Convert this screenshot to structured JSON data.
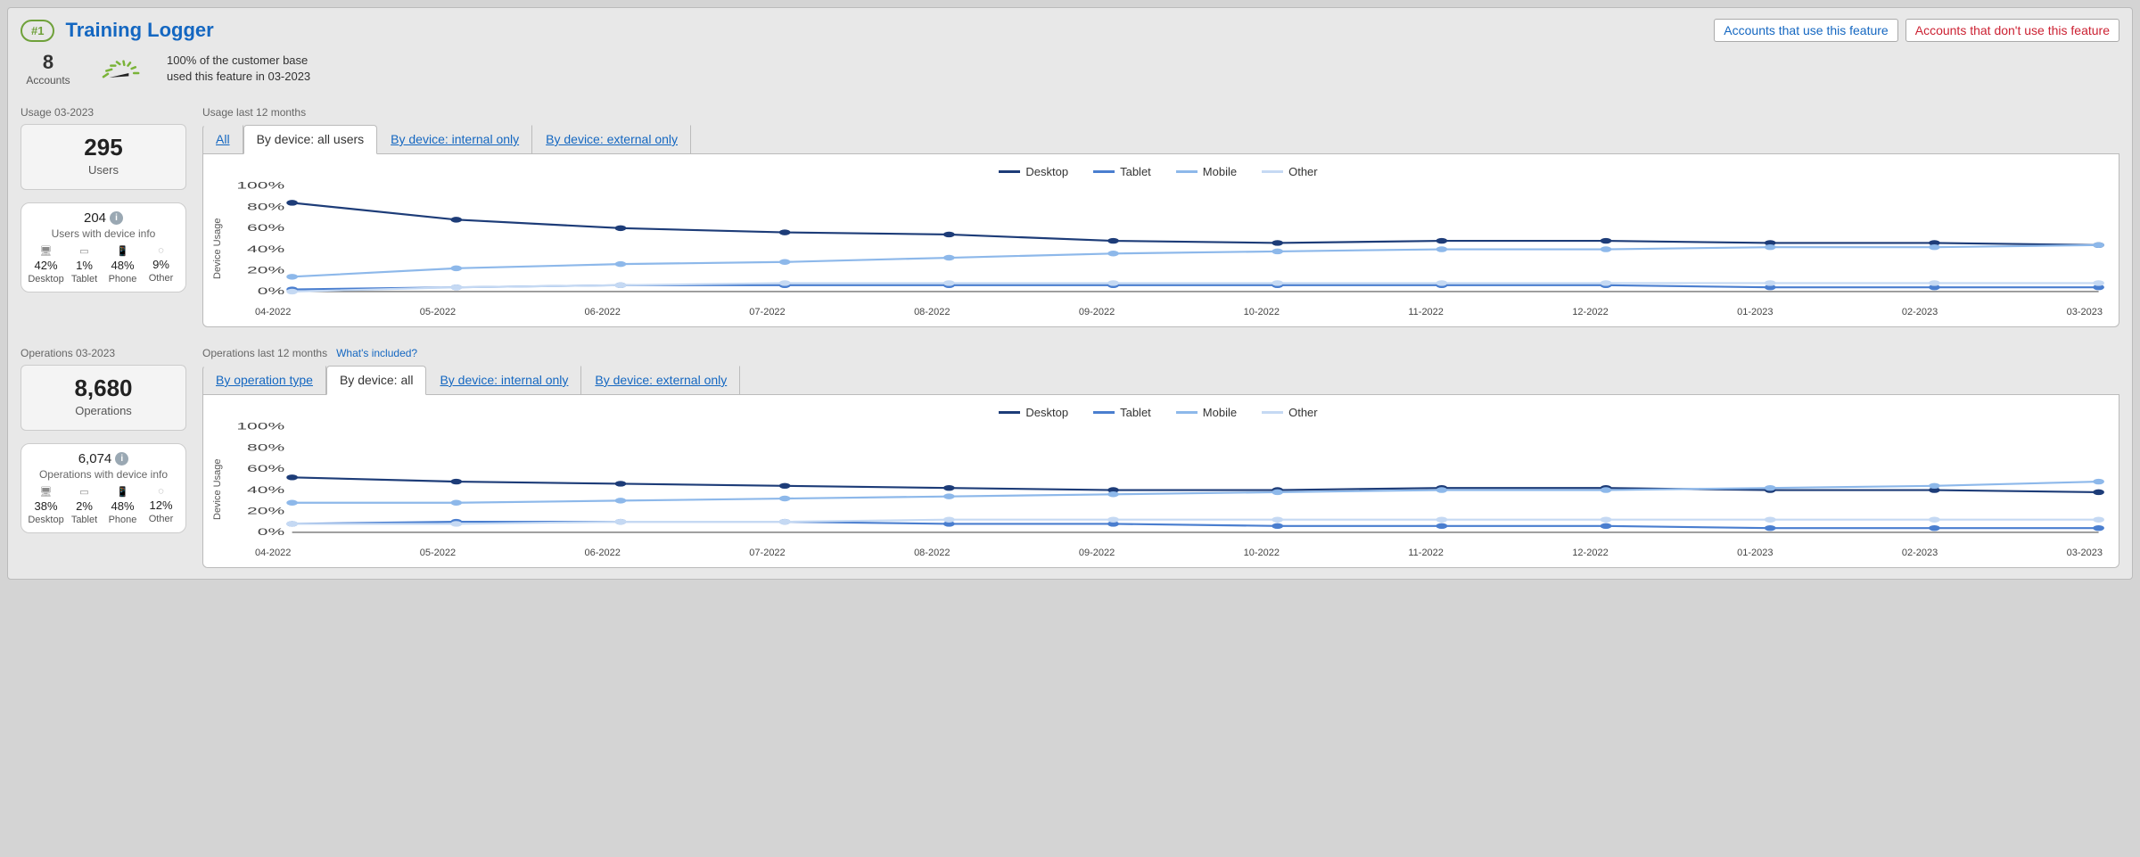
{
  "header": {
    "rank": "#1",
    "title": "Training Logger",
    "btn_use": "Accounts that use this feature",
    "btn_not_use": "Accounts that don't use this feature"
  },
  "summary": {
    "accounts_count": "8",
    "accounts_label": "Accounts",
    "line1": "100% of the customer base",
    "line2": "used this feature in 03-2023"
  },
  "usage": {
    "left_title": "Usage 03-2023",
    "right_title": "Usage last 12 months",
    "users_count": "295",
    "users_label": "Users",
    "device_count": "204",
    "device_label": "Users with device info",
    "breakdown": {
      "desktop": "42%",
      "tablet": "1%",
      "phone": "48%",
      "other": "9%"
    },
    "tabs": {
      "all": "All",
      "by_device_all": "By device: all users",
      "by_device_internal": "By device: internal only",
      "by_device_external": "By device: external only"
    },
    "ylabel": "Device Usage"
  },
  "operations": {
    "left_title": "Operations 03-2023",
    "right_title": "Operations last 12 months",
    "whats_included": "What's included?",
    "ops_count": "8,680",
    "ops_label": "Operations",
    "device_count": "6,074",
    "device_label": "Operations with device info",
    "breakdown": {
      "desktop": "38%",
      "tablet": "2%",
      "phone": "48%",
      "other": "12%"
    },
    "tabs": {
      "by_op_type": "By operation type",
      "by_device_all": "By device: all",
      "by_device_internal": "By device: internal only",
      "by_device_external": "By device: external only"
    },
    "ylabel": "Device Usage"
  },
  "legend": {
    "desktop": "Desktop",
    "tablet": "Tablet",
    "mobile": "Mobile",
    "other": "Other"
  },
  "device_names": {
    "desktop": "Desktop",
    "tablet": "Tablet",
    "phone": "Phone",
    "other": "Other"
  },
  "yticks": [
    "0%",
    "20%",
    "40%",
    "60%",
    "80%",
    "100%"
  ],
  "months": [
    "04-2022",
    "05-2022",
    "06-2022",
    "07-2022",
    "08-2022",
    "09-2022",
    "10-2022",
    "11-2022",
    "12-2022",
    "01-2023",
    "02-2023",
    "03-2023"
  ],
  "chart_data": [
    {
      "type": "line",
      "title": "Usage last 12 months — By device: all users",
      "ylabel": "Device Usage",
      "ylim": [
        0,
        100
      ],
      "x": [
        "04-2022",
        "05-2022",
        "06-2022",
        "07-2022",
        "08-2022",
        "09-2022",
        "10-2022",
        "11-2022",
        "12-2022",
        "01-2023",
        "02-2023",
        "03-2023"
      ],
      "series": [
        {
          "name": "Desktop",
          "values": [
            84,
            68,
            60,
            56,
            54,
            48,
            46,
            48,
            48,
            46,
            46,
            44
          ]
        },
        {
          "name": "Tablet",
          "values": [
            2,
            4,
            6,
            6,
            6,
            6,
            6,
            6,
            6,
            4,
            4,
            4
          ]
        },
        {
          "name": "Mobile",
          "values": [
            14,
            22,
            26,
            28,
            32,
            36,
            38,
            40,
            40,
            42,
            42,
            44
          ]
        },
        {
          "name": "Other",
          "values": [
            0,
            4,
            6,
            8,
            8,
            8,
            8,
            8,
            8,
            8,
            8,
            8
          ]
        }
      ]
    },
    {
      "type": "line",
      "title": "Operations last 12 months — By device: all",
      "ylabel": "Device Usage",
      "ylim": [
        0,
        100
      ],
      "x": [
        "04-2022",
        "05-2022",
        "06-2022",
        "07-2022",
        "08-2022",
        "09-2022",
        "10-2022",
        "11-2022",
        "12-2022",
        "01-2023",
        "02-2023",
        "03-2023"
      ],
      "series": [
        {
          "name": "Desktop",
          "values": [
            52,
            48,
            46,
            44,
            42,
            40,
            40,
            42,
            42,
            40,
            40,
            38
          ]
        },
        {
          "name": "Tablet",
          "values": [
            8,
            10,
            10,
            10,
            8,
            8,
            6,
            6,
            6,
            4,
            4,
            4
          ]
        },
        {
          "name": "Mobile",
          "values": [
            28,
            28,
            30,
            32,
            34,
            36,
            38,
            40,
            40,
            42,
            44,
            48
          ]
        },
        {
          "name": "Other",
          "values": [
            8,
            8,
            10,
            10,
            12,
            12,
            12,
            12,
            12,
            12,
            12,
            12
          ]
        }
      ]
    }
  ],
  "colors": {
    "desktop": "#1d3c78",
    "tablet": "#4a7ecf",
    "mobile": "#8db8ea",
    "other": "#c5d9f3"
  }
}
